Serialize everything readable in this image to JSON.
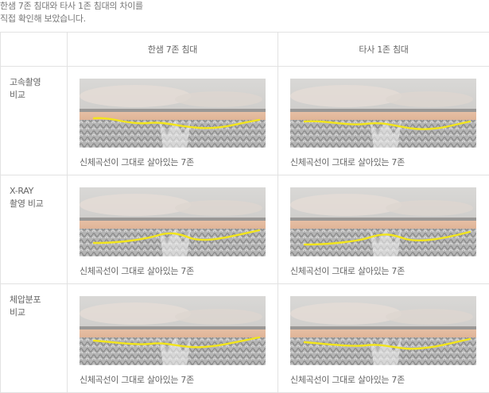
{
  "intro": {
    "line1": "한샘 7존 침대와 타사 1존 침대의 차이를",
    "line2": "직접 확인해 보았습니다."
  },
  "table": {
    "columns": [
      "한샘 7존 침대",
      "타사 1존 침대"
    ],
    "rows": [
      {
        "label_lines": [
          "고속촬영",
          "비교"
        ],
        "captions": [
          "신체곡선이 그대로 살아있는 7존",
          "신체곡선이 그대로 살아있는 7존"
        ]
      },
      {
        "label_lines": [
          "X-RAY",
          "촬영 비교"
        ],
        "captions": [
          "신체곡선이 그대로 살아있는 7존",
          "신체곡선이 그대로 살아있는 7존"
        ]
      },
      {
        "label_lines": [
          "체압분포",
          "비교"
        ],
        "captions": [
          "신체곡선이 그대로 살아있는 7존",
          "신체곡선이 그대로 살아있는 7존"
        ]
      }
    ]
  },
  "colors": {
    "curve": "#f2e51c",
    "foam": "#d9a98a",
    "spring": "#8c8c8c",
    "border": "#e2e2e2"
  }
}
